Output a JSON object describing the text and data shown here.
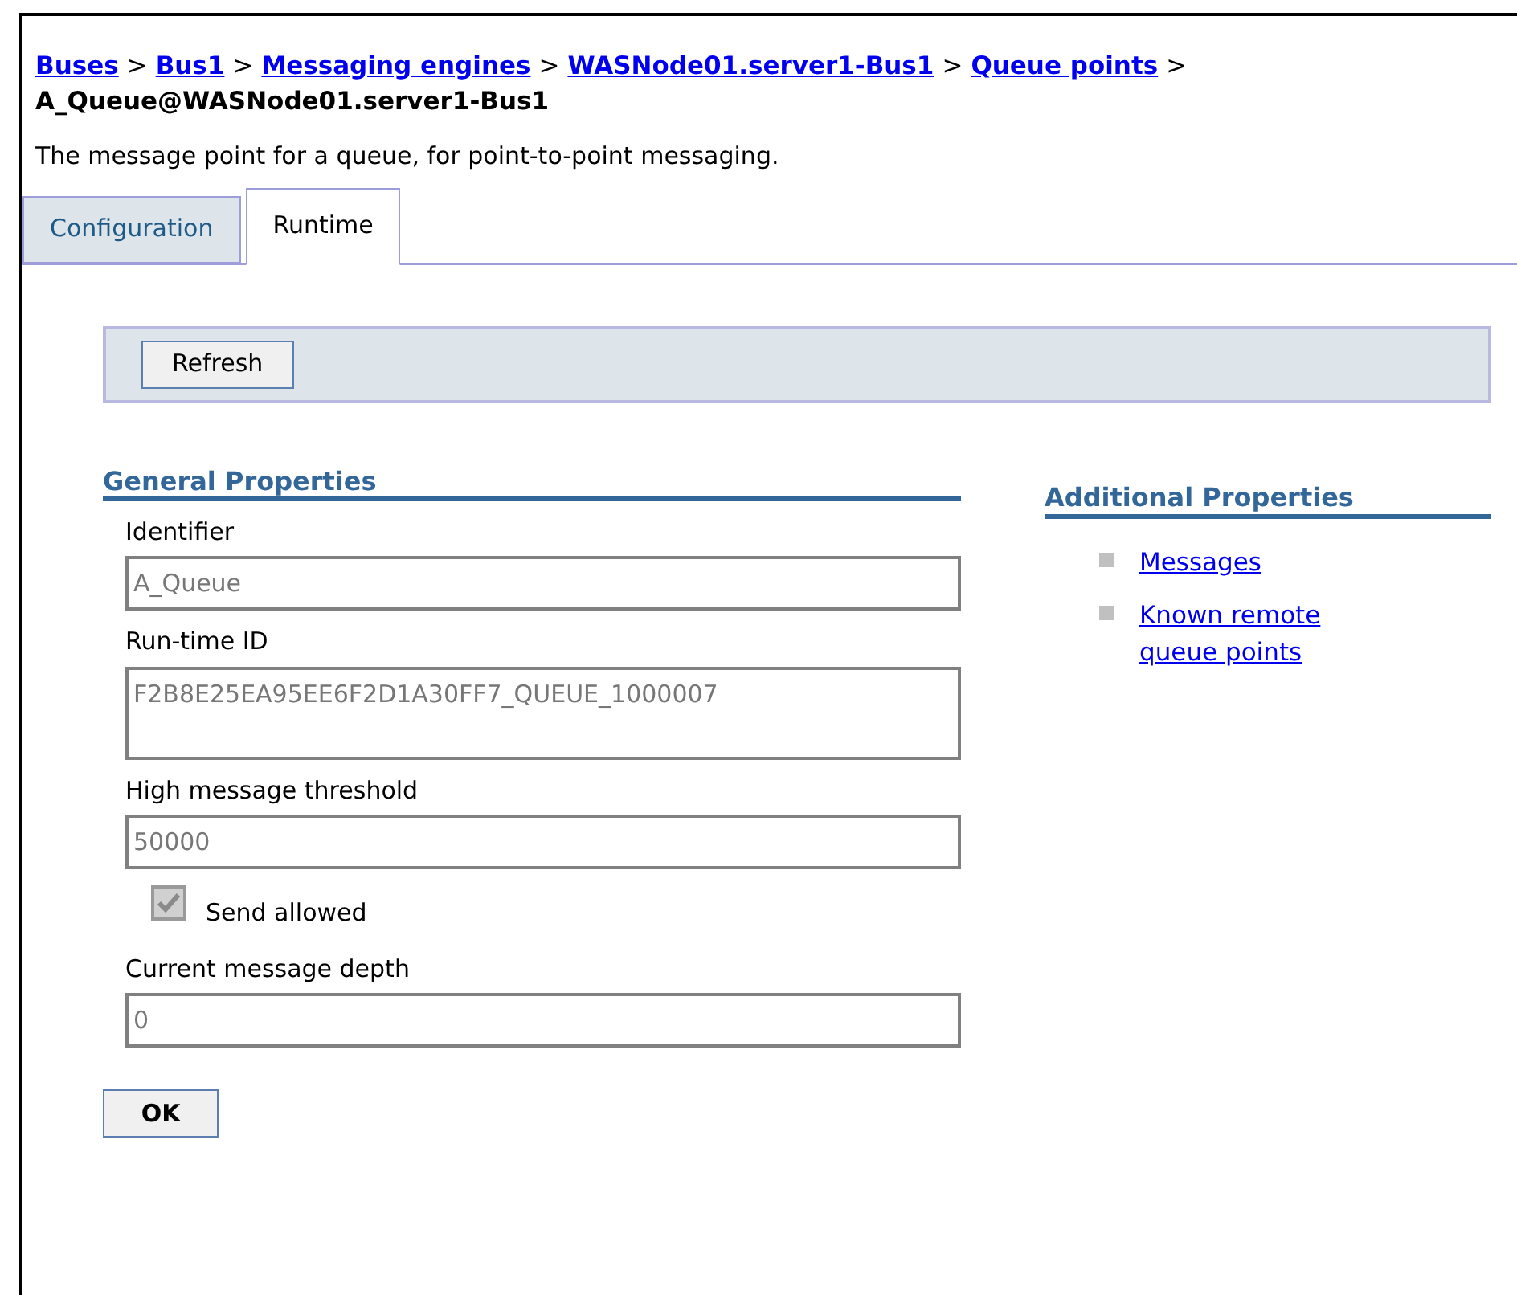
{
  "breadcrumb": {
    "links": [
      {
        "label": "Buses"
      },
      {
        "label": "Bus1"
      },
      {
        "label": "Messaging engines"
      },
      {
        "label": "WASNode01.server1-Bus1"
      },
      {
        "label": "Queue points"
      }
    ],
    "separators": [
      ">",
      ">",
      ">",
      ">",
      ">"
    ],
    "current": "A_Queue@WASNode01.server1-Bus1"
  },
  "description": "The message point for a queue, for point-to-point messaging.",
  "tabs": [
    {
      "label": "Configuration",
      "selected": false
    },
    {
      "label": "Runtime",
      "selected": true
    }
  ],
  "toolbar": {
    "buttons": [
      "Refresh"
    ]
  },
  "general_properties": {
    "title": "General Properties",
    "fields": [
      {
        "kind": "text",
        "label": "Identifier",
        "value": "A_Queue"
      },
      {
        "kind": "textarea",
        "label": "Run-time ID",
        "value": "F2B8E25EA95EE6F2D1A30FF7_QUEUE_1000007"
      },
      {
        "kind": "text",
        "label": "High message threshold",
        "value": "50000"
      },
      {
        "kind": "checkbox",
        "label": "Send allowed",
        "checked": true,
        "disabled": true
      },
      {
        "kind": "text",
        "label": "Current message depth",
        "value": "0"
      }
    ]
  },
  "additional_properties": {
    "title": "Additional Properties",
    "links": [
      {
        "label": "Messages"
      },
      {
        "label": "Known remote queue points"
      }
    ]
  },
  "ok_button": "OK"
}
